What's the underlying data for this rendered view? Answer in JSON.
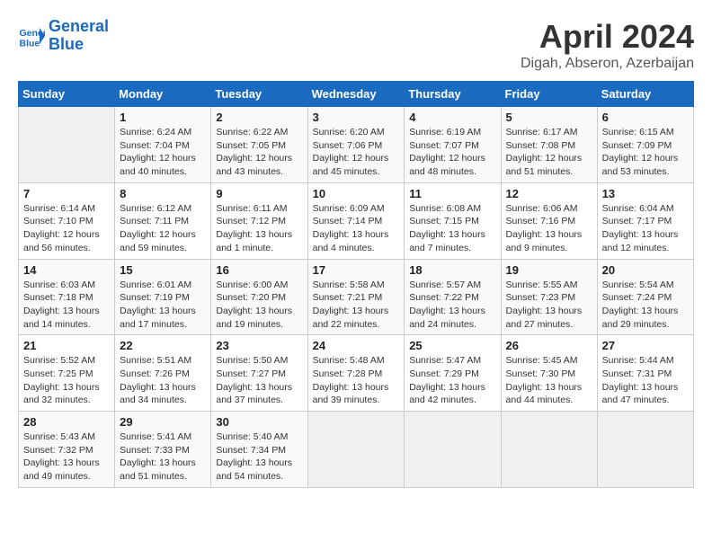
{
  "header": {
    "logo_line1": "General",
    "logo_line2": "Blue",
    "month": "April 2024",
    "location": "Digah, Abseron, Azerbaijan"
  },
  "weekdays": [
    "Sunday",
    "Monday",
    "Tuesday",
    "Wednesday",
    "Thursday",
    "Friday",
    "Saturday"
  ],
  "weeks": [
    [
      {
        "day": "",
        "info": ""
      },
      {
        "day": "1",
        "info": "Sunrise: 6:24 AM\nSunset: 7:04 PM\nDaylight: 12 hours\nand 40 minutes."
      },
      {
        "day": "2",
        "info": "Sunrise: 6:22 AM\nSunset: 7:05 PM\nDaylight: 12 hours\nand 43 minutes."
      },
      {
        "day": "3",
        "info": "Sunrise: 6:20 AM\nSunset: 7:06 PM\nDaylight: 12 hours\nand 45 minutes."
      },
      {
        "day": "4",
        "info": "Sunrise: 6:19 AM\nSunset: 7:07 PM\nDaylight: 12 hours\nand 48 minutes."
      },
      {
        "day": "5",
        "info": "Sunrise: 6:17 AM\nSunset: 7:08 PM\nDaylight: 12 hours\nand 51 minutes."
      },
      {
        "day": "6",
        "info": "Sunrise: 6:15 AM\nSunset: 7:09 PM\nDaylight: 12 hours\nand 53 minutes."
      }
    ],
    [
      {
        "day": "7",
        "info": "Sunrise: 6:14 AM\nSunset: 7:10 PM\nDaylight: 12 hours\nand 56 minutes."
      },
      {
        "day": "8",
        "info": "Sunrise: 6:12 AM\nSunset: 7:11 PM\nDaylight: 12 hours\nand 59 minutes."
      },
      {
        "day": "9",
        "info": "Sunrise: 6:11 AM\nSunset: 7:12 PM\nDaylight: 13 hours\nand 1 minute."
      },
      {
        "day": "10",
        "info": "Sunrise: 6:09 AM\nSunset: 7:14 PM\nDaylight: 13 hours\nand 4 minutes."
      },
      {
        "day": "11",
        "info": "Sunrise: 6:08 AM\nSunset: 7:15 PM\nDaylight: 13 hours\nand 7 minutes."
      },
      {
        "day": "12",
        "info": "Sunrise: 6:06 AM\nSunset: 7:16 PM\nDaylight: 13 hours\nand 9 minutes."
      },
      {
        "day": "13",
        "info": "Sunrise: 6:04 AM\nSunset: 7:17 PM\nDaylight: 13 hours\nand 12 minutes."
      }
    ],
    [
      {
        "day": "14",
        "info": "Sunrise: 6:03 AM\nSunset: 7:18 PM\nDaylight: 13 hours\nand 14 minutes."
      },
      {
        "day": "15",
        "info": "Sunrise: 6:01 AM\nSunset: 7:19 PM\nDaylight: 13 hours\nand 17 minutes."
      },
      {
        "day": "16",
        "info": "Sunrise: 6:00 AM\nSunset: 7:20 PM\nDaylight: 13 hours\nand 19 minutes."
      },
      {
        "day": "17",
        "info": "Sunrise: 5:58 AM\nSunset: 7:21 PM\nDaylight: 13 hours\nand 22 minutes."
      },
      {
        "day": "18",
        "info": "Sunrise: 5:57 AM\nSunset: 7:22 PM\nDaylight: 13 hours\nand 24 minutes."
      },
      {
        "day": "19",
        "info": "Sunrise: 5:55 AM\nSunset: 7:23 PM\nDaylight: 13 hours\nand 27 minutes."
      },
      {
        "day": "20",
        "info": "Sunrise: 5:54 AM\nSunset: 7:24 PM\nDaylight: 13 hours\nand 29 minutes."
      }
    ],
    [
      {
        "day": "21",
        "info": "Sunrise: 5:52 AM\nSunset: 7:25 PM\nDaylight: 13 hours\nand 32 minutes."
      },
      {
        "day": "22",
        "info": "Sunrise: 5:51 AM\nSunset: 7:26 PM\nDaylight: 13 hours\nand 34 minutes."
      },
      {
        "day": "23",
        "info": "Sunrise: 5:50 AM\nSunset: 7:27 PM\nDaylight: 13 hours\nand 37 minutes."
      },
      {
        "day": "24",
        "info": "Sunrise: 5:48 AM\nSunset: 7:28 PM\nDaylight: 13 hours\nand 39 minutes."
      },
      {
        "day": "25",
        "info": "Sunrise: 5:47 AM\nSunset: 7:29 PM\nDaylight: 13 hours\nand 42 minutes."
      },
      {
        "day": "26",
        "info": "Sunrise: 5:45 AM\nSunset: 7:30 PM\nDaylight: 13 hours\nand 44 minutes."
      },
      {
        "day": "27",
        "info": "Sunrise: 5:44 AM\nSunset: 7:31 PM\nDaylight: 13 hours\nand 47 minutes."
      }
    ],
    [
      {
        "day": "28",
        "info": "Sunrise: 5:43 AM\nSunset: 7:32 PM\nDaylight: 13 hours\nand 49 minutes."
      },
      {
        "day": "29",
        "info": "Sunrise: 5:41 AM\nSunset: 7:33 PM\nDaylight: 13 hours\nand 51 minutes."
      },
      {
        "day": "30",
        "info": "Sunrise: 5:40 AM\nSunset: 7:34 PM\nDaylight: 13 hours\nand 54 minutes."
      },
      {
        "day": "",
        "info": ""
      },
      {
        "day": "",
        "info": ""
      },
      {
        "day": "",
        "info": ""
      },
      {
        "day": "",
        "info": ""
      }
    ]
  ]
}
